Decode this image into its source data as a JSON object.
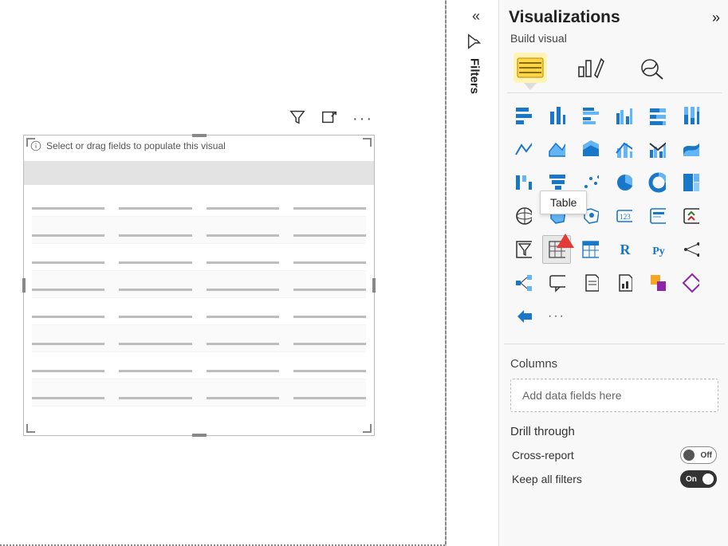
{
  "canvas": {
    "visual_hint": "Select or drag fields to populate this visual"
  },
  "filters_tab": {
    "label": "Filters"
  },
  "viz_pane": {
    "title": "Visualizations",
    "subtitle": "Build visual",
    "tooltip_table": "Table",
    "columns_label": "Columns",
    "field_well_placeholder": "Add data fields here",
    "drill_heading": "Drill through",
    "cross_report_label": "Cross-report",
    "cross_report_state": "Off",
    "keep_filters_label": "Keep all filters",
    "keep_filters_state": "On"
  }
}
